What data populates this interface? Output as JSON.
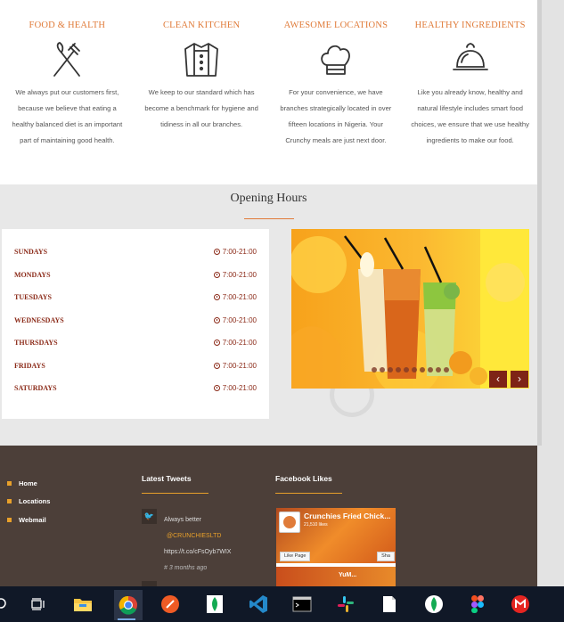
{
  "features": [
    {
      "title": "FOOD & HEALTH",
      "icon": "fork-knife-icon",
      "text": "We always put our customers first, because we believe that eating a healthy balanced diet is an important part of maintaining good health."
    },
    {
      "title": "CLEAN KITCHEN",
      "icon": "chef-jacket-icon",
      "text": "We keep to our standard which has become a benchmark for hygiene and tidiness in all our branches."
    },
    {
      "title": "AWESOME LOCATIONS",
      "icon": "chef-hat-icon",
      "text": "For your convenience, we have branches strategically located in over fifteen locations in Nigeria. Your Crunchy meals are just next door."
    },
    {
      "title": "HEALTHY INGREDIENTS",
      "icon": "food-cloche-icon",
      "text": "Like you already know, healthy and natural lifestyle includes smart food choices, we ensure that we use healthy ingredients to make our food."
    }
  ],
  "opening_hours": {
    "title": "Opening Hours",
    "rows": [
      {
        "day": "SUNDAYS",
        "time": "7:00-21:00"
      },
      {
        "day": "MONDAYS",
        "time": "7:00-21:00"
      },
      {
        "day": "TUESDAYS",
        "time": "7:00-21:00"
      },
      {
        "day": "WEDNESDAYS",
        "time": "7:00-21:00"
      },
      {
        "day": "THURSDAYS",
        "time": "7:00-21:00"
      },
      {
        "day": "FRIDAYS",
        "time": "7:00-21:00"
      },
      {
        "day": "SATURDAYS",
        "time": "7:00-21:00"
      }
    ]
  },
  "slider": {
    "prev": "‹",
    "next": "›",
    "dot_count": 10
  },
  "footer": {
    "links": [
      "Home",
      "Locations",
      "Webmail"
    ],
    "tweets_heading": "Latest Tweets",
    "tweet": {
      "text": "Always better",
      "handle": "@CRUNCHIESLTD",
      "link": "https://t.co/cFsOyb7WIX",
      "time": "# 3 months ago"
    },
    "facebook_heading": "Facebook Likes",
    "facebook": {
      "page_name": "Crunchies Fried Chick...",
      "likes": "21,510 likes",
      "like_button": "Like Page",
      "share_button": "Sha",
      "post_text": "YuM..."
    }
  },
  "colors": {
    "accent": "#e07b39",
    "hours_text": "#8b2a18",
    "footer_bg": "#4c3f39",
    "taskbar_bg": "#101827"
  },
  "taskbar": [
    "task-view-icon",
    "file-explorer-icon",
    "chrome-icon",
    "postman-icon",
    "mongodb-compass-icon",
    "vscode-icon",
    "terminal-icon",
    "slack-icon",
    "notepad-icon",
    "mongodb-icon",
    "figma-icon",
    "gmail-icon"
  ]
}
